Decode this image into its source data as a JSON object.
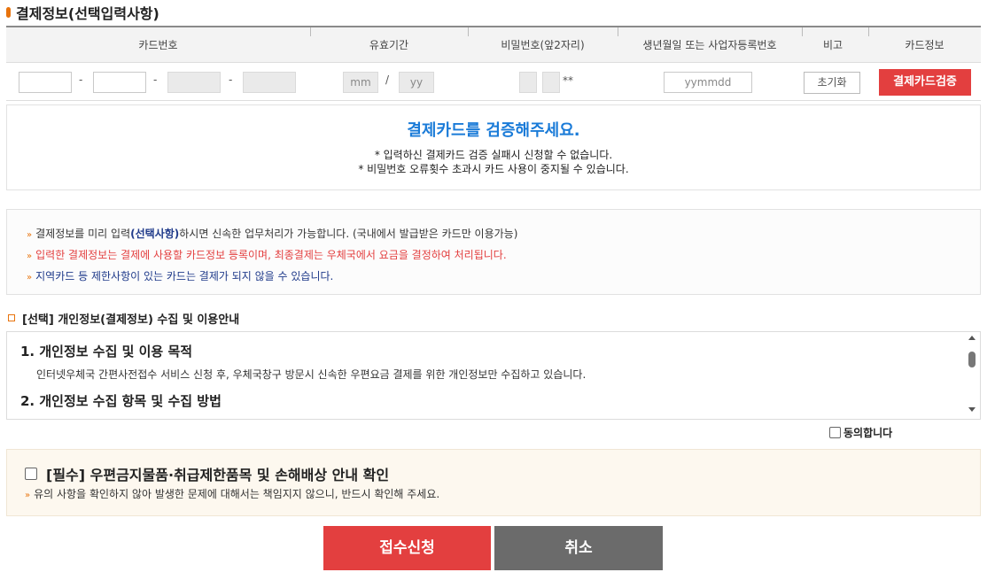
{
  "payment_section": {
    "title": "결제정보(선택입력사항)"
  },
  "card_table": {
    "headers": {
      "card_number": "카드번호",
      "expiry": "유효기간",
      "password": "비밀번호(앞2자리)",
      "birth_or_biz": "생년월일 또는 사업자등록번호",
      "note": "비고",
      "card_info": "카드정보"
    },
    "dash": "-",
    "slash": "/",
    "expiry_month_placeholder": "mm",
    "expiry_year_placeholder": "yy",
    "password_mask": "**",
    "birth_placeholder": "yymmdd",
    "reset_label": "초기화",
    "verify_label": "결제카드검증"
  },
  "verify_message": {
    "title": "결제카드를 검증해주세요.",
    "line1": "* 입력하신 결제카드 검증 실패시 신청할 수 없습니다.",
    "line2": "* 비밀번호 오류횟수 초과시 카드 사용이 중지될 수 있습니다."
  },
  "notes": {
    "arrow": "»",
    "n1_pre": "결제정보를 미리 입력",
    "n1_bold": "(선택사항)",
    "n1_post": "하시면 신속한 업무처리가 가능합니다. (국내에서 발급받은 카드만 이용가능)",
    "n2": "입력한 결제정보는 결제에 사용할 카드정보 등록이며, 최종결제는 우체국에서 요금을 결정하여 처리됩니다.",
    "n3": "지역카드 등 제한사항이 있는 카드는 결제가 되지 않을 수 있습니다."
  },
  "privacy": {
    "title": "[선택] 개인정보(결제정보) 수집 및 이용안내",
    "h1": "1. 개인정보 수집 및 이용 목적",
    "p1": "인터넷우체국 간편사전접수 서비스 신청 후, 우체국창구 방문시 신속한 우편요금 결제를 위한 개인정보만 수집하고 있습니다.",
    "h2": "2. 개인정보 수집 항목 및 수집 방법",
    "agree_label": "동의합니다"
  },
  "required": {
    "title": "[필수] 우편금지물품·취급제한품목 및 손해배상 안내 확인",
    "arrow": "»",
    "subtitle": "유의 사항을 확인하지 않아 발생한 문제에 대해서는 책임지지 않으니, 반드시 확인해 주세요."
  },
  "actions": {
    "submit": "접수신청",
    "cancel": "취소"
  },
  "colors": {
    "accent_orange": "#e8730c",
    "primary_red": "#e33f3f",
    "title_blue": "#1a7bd8",
    "cancel_gray": "#6b6b6b"
  }
}
